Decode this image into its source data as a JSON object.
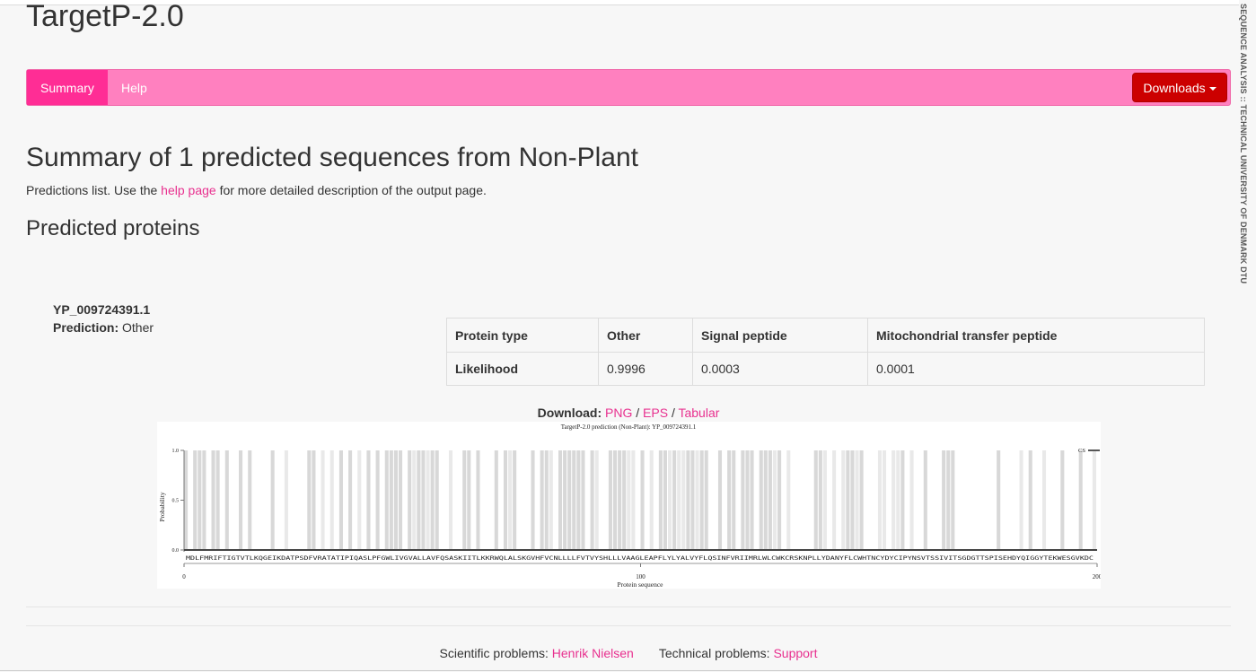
{
  "app": {
    "title": "TargetP-2.0",
    "side_banner": "SEQUENCE ANALYSIS :: TECHNICAL UNIVERSITY OF DENMARK DTU"
  },
  "navbar": {
    "tabs": [
      {
        "label": "Summary",
        "active": true
      },
      {
        "label": "Help",
        "active": false
      }
    ],
    "downloads_label": "Downloads",
    "colors": {
      "bar": "#ff80bf",
      "active_tab": "#ff2d95",
      "downloads_button": "#cc0000"
    }
  },
  "page": {
    "heading": "Summary of 1 predicted sequences from Non-Plant",
    "intro_before": "Predictions list. Use the ",
    "intro_link": "help page",
    "intro_after": " for more detailed description of the output page.",
    "section_heading": "Predicted proteins"
  },
  "protein": {
    "id": "YP_009724391.1",
    "prediction_label": "Prediction:",
    "prediction_value": "Other",
    "table": {
      "headers": [
        "Protein type",
        "Other",
        "Signal peptide",
        "Mitochondrial transfer peptide"
      ],
      "rows": [
        [
          "Likelihood",
          "0.9996",
          "0.0003",
          "0.0001"
        ]
      ]
    }
  },
  "download": {
    "label": "Download:",
    "png": "PNG",
    "eps": "EPS",
    "tabular": "Tabular",
    "sep": "/"
  },
  "chart_data": {
    "type": "line",
    "title": "TargetP-2.0 prediction (Non-Plant): YP_009724391.1",
    "xlabel": "Protein sequence",
    "ylabel": "Probability",
    "xlim": [
      0,
      200
    ],
    "ylim": [
      0,
      1
    ],
    "x_ticks": [
      "0",
      "100",
      "200"
    ],
    "y_ticks": [
      "0.0",
      "0.5",
      "1.0"
    ],
    "legend": [
      "CS"
    ],
    "sequence": "MDLFMRIFTIGTVTLKQGEIKDATPSDFVRATATIPIQASLPFGWLIVGVALLAVFQSASKIITLKKRWQLALSKGVHFVCNLLLLFVTVYSHLLLVAAGLEAPFLYLYALVYFLQSINFVRIIMRLWLCWKCRSKNPLLYDANYFLCWHTNCYDYCIPYNSVTSSIVITSGDGTTSPISEHDYQIGGYTEKWESGVKDC",
    "series": [
      {
        "name": "CS",
        "values": [
          0,
          0,
          0,
          0,
          0,
          0,
          0,
          0,
          0,
          0
        ]
      }
    ]
  },
  "footer": {
    "scientific_label": "Scientific problems:",
    "scientific_link": "Henrik Nielsen",
    "technical_label": "Technical problems:",
    "technical_link": "Support"
  }
}
